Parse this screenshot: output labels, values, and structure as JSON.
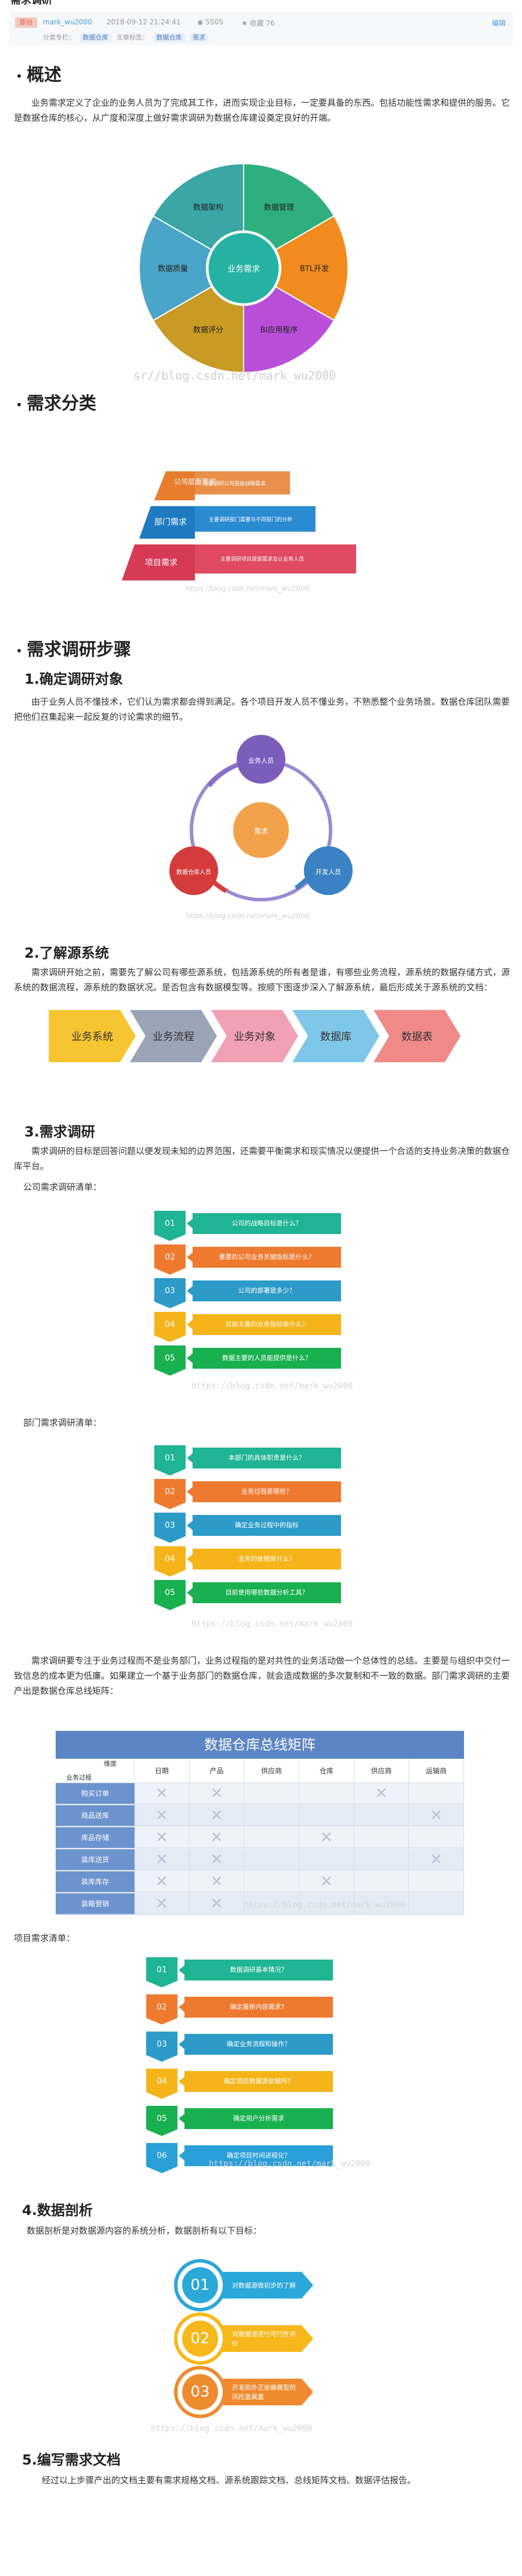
{
  "page": {
    "title_fragment": "数据仓库（一）需求调研",
    "badge": "原创",
    "author": "mark_wu2000",
    "date": "2018-09-12 21:24:41",
    "views": "5505",
    "favorites": "收藏 76",
    "edit": "编辑",
    "category_label": "分类专栏：",
    "tags": [
      "数据仓库",
      "文章标签：",
      "数据仓库",
      "需求"
    ],
    "watermark": "https://blog.csdn.net/mark_wu2000",
    "watermark_short": "sr//blog.csdn.net/mark_wu2000"
  },
  "sections": {
    "overview": {
      "heading": "概述",
      "text": "业务需求定义了企业的业务人员为了完成其工作，进而实现企业目标，一定要具备的东西。包括功能性需求和提供的服务。它是数据仓库的核心，从广度和深度上做好需求调研为数据仓库建设奠定良好的开端。",
      "wheel": {
        "center": "业务需求",
        "segments": [
          "数据管理",
          "BTL开发",
          "BI应用程序",
          "数据评分",
          "数据质量",
          "数据架构"
        ],
        "colors": [
          "#2eaf7d",
          "#f28b1e",
          "#b94fd8",
          "#c99a24",
          "#4aa5c8",
          "#3aa6a6"
        ]
      }
    },
    "classification": {
      "heading": "需求分类",
      "levels": [
        {
          "label": "项目需求",
          "desc": "主要调研项目层面需求及认业务人员",
          "color": "#d63a55"
        },
        {
          "label": "部门需求",
          "desc": "主要调研部门需要与不同部门的分析",
          "color": "#1e7bc2"
        },
        {
          "label": "公司层面需求",
          "desc": "主要调研公司层面战略需求",
          "color": "#e67e2e"
        }
      ]
    },
    "research": {
      "heading": "需求调研步骤",
      "step1": {
        "heading": "1.确定调研对象",
        "text": "由于业务人员不懂技术，它们认为需求都会得到满足。各个项目开发人员不懂业务，不熟悉整个业务场景。数据仓库团队需要把他们召集起来一起反复的讨论需求的细节。",
        "cycle": [
          "业务人员",
          "开发人员",
          "数据仓库人员"
        ],
        "cycle_center": "需求"
      },
      "step2": {
        "heading": "2.了解源系统",
        "text": "需求调研开始之前，需要先了解公司有哪些源系统，包括源系统的所有者是谁，有哪些业务流程，源系统的数据存储方式，源系统的数据流程，源系统的数据状况。是否包含有数据模型等。按顺下图逐步深入了解源系统，最后形成关于源系统的文档：",
        "chevrons": [
          {
            "label": "业务系统",
            "color": "#f7c532"
          },
          {
            "label": "业务流程",
            "color": "#9aa4b5"
          },
          {
            "label": "业务对象",
            "color": "#f2a0b4"
          },
          {
            "label": "数据库",
            "color": "#7fc7e8"
          },
          {
            "label": "数据表",
            "color": "#f08a88"
          }
        ]
      },
      "step3": {
        "heading": "3.需求调研",
        "text": "需求调研的目标是回答问题以便发现未知的边界范围，还需要平衡需求和现实情况以便提供一个合适的支持业务决策的数据仓库平台。",
        "company_label": "公司需求调研清单：",
        "company_items": [
          "公司的战略目标是什么？",
          "重要的公司业务关键指标是什么？",
          "公司的部署是多少？",
          "目前主要的业务指标是什么？",
          "数据主要的人员能提供是什么？"
        ],
        "dept_label": "部门需求调研清单：",
        "dept_items": [
          "本部门的具体职责是什么？",
          "业务过程是哪些？",
          "确定业务过程中的指标",
          "业务的依据有什么？",
          "目前使用哪些数据分析工具？"
        ],
        "mid_text": "需求调研要专注于业务过程而不是业务部门，业务过程指的是对共性的业务活动做一个总体性的总结。主要是与组织中交付一致信息的成本更为低廉。如果建立一个基于业务部门的数据仓库，就会造成数据的多次复制和不一致的数据。部门需求调研的主要产出是数据仓库总线矩阵：",
        "matrix": {
          "title": "数据仓库总线矩阵",
          "corner_top": "维度",
          "corner_bottom": "业务过程",
          "dims": [
            "日期",
            "产品",
            "供应商",
            "仓库",
            "供应商",
            "运输商"
          ],
          "rows": [
            {
              "label": "购买订单",
              "marks": [
                1,
                1,
                0,
                0,
                1,
                0
              ]
            },
            {
              "label": "商品送库",
              "marks": [
                1,
                1,
                0,
                0,
                0,
                1
              ]
            },
            {
              "label": "库品存储",
              "marks": [
                1,
                1,
                0,
                1,
                0,
                0
              ]
            },
            {
              "label": "装库送货",
              "marks": [
                1,
                1,
                0,
                0,
                0,
                1
              ]
            },
            {
              "label": "装库库存",
              "marks": [
                1,
                1,
                0,
                1,
                0,
                0
              ]
            },
            {
              "label": "装箱营销",
              "marks": [
                1,
                1,
                0,
                0,
                0,
                0
              ]
            }
          ]
        },
        "project_label": "项目需求清单：",
        "project_items": [
          "数据调研基本情况？",
          "确定最新内容需求？",
          "确定业务流程和操作？",
          "确定项目数据源依据吗？",
          "确定用户分析需求",
          "确定项目时间进程化？"
        ]
      },
      "step4": {
        "heading": "4.数据剖析",
        "text": "数据剖析是对数据源内容的系统分析，数据剖析有以下目标：",
        "goals": [
          {
            "num": "01",
            "text": "对数据源做初步的了解",
            "color": "#2aa8d8"
          },
          {
            "num": "02",
            "text": "对数据源进行可行性评价",
            "color": "#f6b81a"
          },
          {
            "num": "03",
            "text": "开发和外正依赖模型的风险直属量",
            "color": "#ee8b2f"
          }
        ]
      },
      "step5": {
        "heading": "5.编写需求文档",
        "text": "经过以上步骤产出的文档主要有需求规格文档、源系统跟踪文档、总线矩阵文档、数据评估报告。"
      }
    }
  },
  "list_colors": [
    "#1fb493",
    "#ee7a2f",
    "#2c9bc8",
    "#f4b41a",
    "#19b050",
    "#2a9fd8"
  ]
}
